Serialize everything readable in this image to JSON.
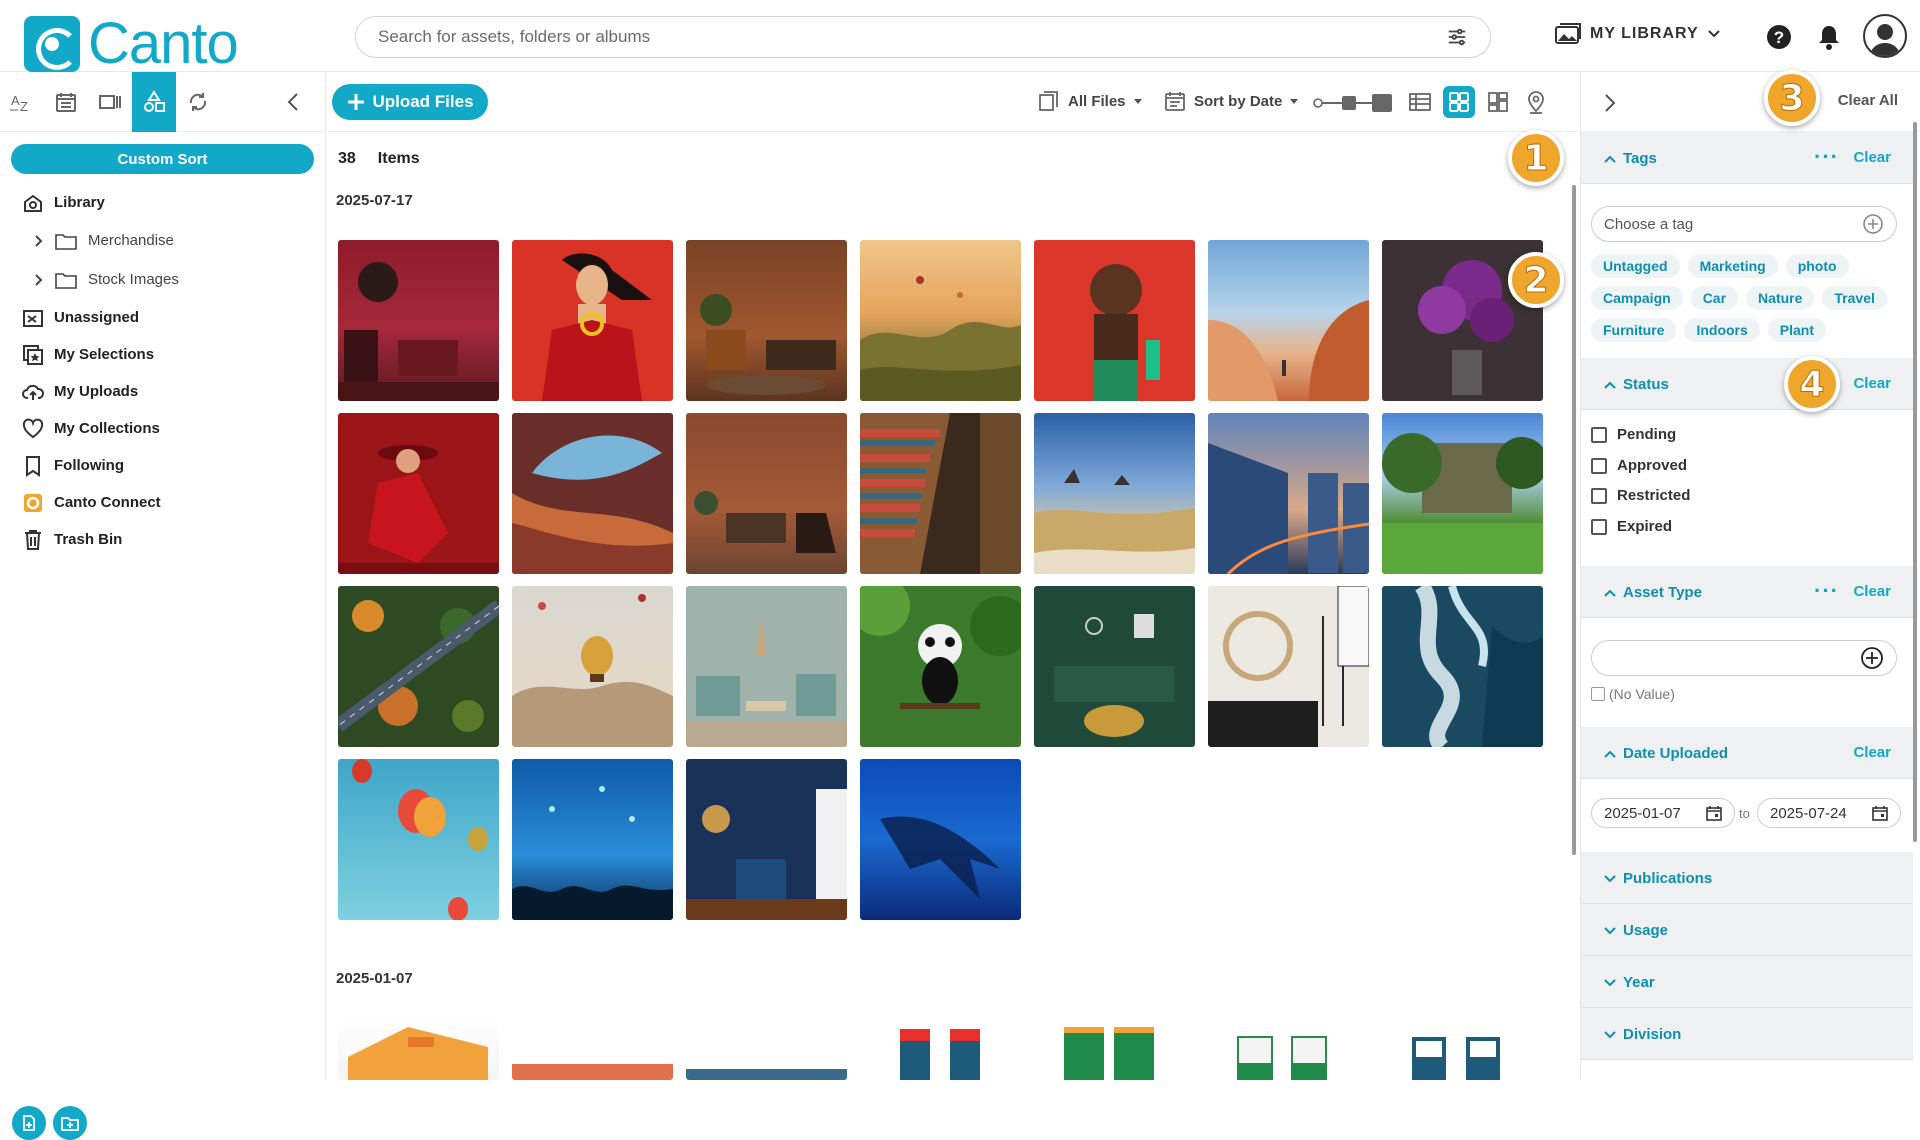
{
  "brand": {
    "name": "Canto"
  },
  "search": {
    "placeholder": "Search for assets, folders or albums"
  },
  "header": {
    "library_label": "MY LIBRARY"
  },
  "sidebar": {
    "custom_sort": "Custom Sort",
    "items": [
      {
        "label": "Library",
        "icon": "library-icon"
      },
      {
        "label": "Merchandise",
        "icon": "folder-icon",
        "sub": true
      },
      {
        "label": "Stock Images",
        "icon": "folder-icon",
        "sub": true
      },
      {
        "label": "Unassigned",
        "icon": "unassigned-icon"
      },
      {
        "label": "My Selections",
        "icon": "selections-icon"
      },
      {
        "label": "My Uploads",
        "icon": "upload-cloud-icon"
      },
      {
        "label": "My Collections",
        "icon": "heart-icon"
      },
      {
        "label": "Following",
        "icon": "bookmark-icon"
      },
      {
        "label": "Canto Connect",
        "icon": "canto-connect-icon"
      },
      {
        "label": "Trash Bin",
        "icon": "trash-icon"
      }
    ]
  },
  "toolbar": {
    "upload_label": "Upload Files",
    "all_files": "All Files",
    "sort": "Sort by Date"
  },
  "content": {
    "count": "38",
    "items_label": "Items",
    "groups": [
      {
        "date": "2025-07-17"
      },
      {
        "date": "2025-01-07"
      }
    ]
  },
  "filters": {
    "clear_all": "Clear All",
    "tags": {
      "title": "Tags",
      "clear": "Clear",
      "placeholder": "Choose a tag",
      "list": [
        "Untagged",
        "Marketing",
        "photo",
        "Campaign",
        "Car",
        "Nature",
        "Travel",
        "Furniture",
        "Indoors",
        "Plant"
      ]
    },
    "status": {
      "title": "Status",
      "clear": "Clear",
      "options": [
        "Pending",
        "Approved",
        "Restricted",
        "Expired"
      ]
    },
    "asset_type": {
      "title": "Asset Type",
      "clear": "Clear",
      "no_value": "(No Value)"
    },
    "date_uploaded": {
      "title": "Date Uploaded",
      "clear": "Clear",
      "from": "2025-01-07",
      "to_label": "to",
      "to": "2025-07-24"
    },
    "collapsed": [
      "Publications",
      "Usage",
      "Year",
      "Division"
    ]
  },
  "callouts": [
    "1",
    "2",
    "3",
    "4"
  ],
  "colors": {
    "accent": "#12a8c8",
    "callout": "#f0a52b"
  }
}
